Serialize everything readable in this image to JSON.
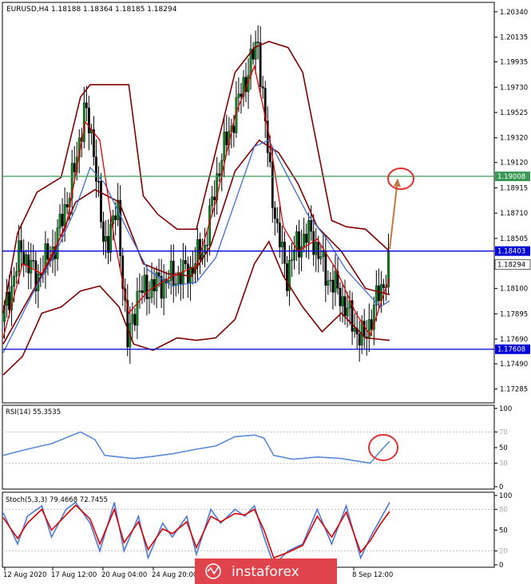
{
  "chart_data": [
    {
      "type": "candlestick",
      "title": "EURUSD,H4  1.18188 1.18364 1.18185 1.18294",
      "ylim": [
        1.1718,
        1.2041
      ],
      "y_ticks": [
        "1.20340",
        "1.20135",
        "1.19935",
        "1.19730",
        "1.19525",
        "1.19320",
        "1.19120",
        "1.18915",
        "1.18710",
        "1.18505",
        "1.18300",
        "1.18100",
        "1.17895",
        "1.17690",
        "1.17490",
        "1.17285"
      ],
      "x_ticks": [
        "12 Aug 2020",
        "17 Aug 12:00",
        "20 Aug 04:00",
        "24 Aug 20:00",
        "8 Sep 12:00"
      ],
      "n_bars": 160,
      "close_path": [
        [
          0,
          1.1783
        ],
        [
          8,
          1.1842
        ],
        [
          14,
          1.1818
        ],
        [
          22,
          1.1845
        ],
        [
          30,
          1.1905
        ],
        [
          34,
          1.1955
        ],
        [
          38,
          1.1925
        ],
        [
          42,
          1.1845
        ],
        [
          48,
          1.1872
        ],
        [
          52,
          1.1765
        ],
        [
          56,
          1.1805
        ],
        [
          62,
          1.1812
        ],
        [
          70,
          1.1818
        ],
        [
          78,
          1.1825
        ],
        [
          84,
          1.1845
        ],
        [
          90,
          1.191
        ],
        [
          100,
          1.1975
        ],
        [
          106,
          1.201
        ],
        [
          110,
          1.192
        ],
        [
          114,
          1.1855
        ],
        [
          118,
          1.1822
        ],
        [
          122,
          1.1845
        ],
        [
          128,
          1.1855
        ],
        [
          134,
          1.1822
        ],
        [
          140,
          1.1805
        ],
        [
          146,
          1.1778
        ],
        [
          150,
          1.1768
        ],
        [
          154,
          1.1795
        ],
        [
          158,
          1.1815
        ],
        [
          160,
          1.1829
        ]
      ],
      "series": [
        {
          "name": "Bollinger Upper",
          "color": "#800000",
          "values": [
            [
              0,
              1.179
            ],
            [
              6,
              1.1855
            ],
            [
              14,
              1.1888
            ],
            [
              24,
              1.19
            ],
            [
              32,
              1.1965
            ],
            [
              36,
              1.1975
            ],
            [
              44,
              1.1975
            ],
            [
              52,
              1.1975
            ],
            [
              58,
              1.1885
            ],
            [
              64,
              1.187
            ],
            [
              72,
              1.1858
            ],
            [
              80,
              1.1858
            ],
            [
              86,
              1.1905
            ],
            [
              96,
              1.1985
            ],
            [
              104,
              1.2005
            ],
            [
              110,
              1.201
            ],
            [
              118,
              1.2005
            ],
            [
              124,
              1.1985
            ],
            [
              130,
              1.1925
            ],
            [
              136,
              1.1865
            ],
            [
              142,
              1.186
            ],
            [
              150,
              1.1858
            ],
            [
              160,
              1.184
            ]
          ]
        },
        {
          "name": "Bollinger Middle",
          "color": "#800000",
          "values": [
            [
              0,
              1.1765
            ],
            [
              10,
              1.18
            ],
            [
              20,
              1.1835
            ],
            [
              30,
              1.188
            ],
            [
              38,
              1.189
            ],
            [
              48,
              1.188
            ],
            [
              58,
              1.183
            ],
            [
              68,
              1.1822
            ],
            [
              78,
              1.182
            ],
            [
              86,
              1.1845
            ],
            [
              96,
              1.1905
            ],
            [
              106,
              1.193
            ],
            [
              114,
              1.192
            ],
            [
              122,
              1.1895
            ],
            [
              130,
              1.186
            ],
            [
              140,
              1.184
            ],
            [
              150,
              1.181
            ],
            [
              160,
              1.1805
            ]
          ]
        },
        {
          "name": "Bollinger Lower",
          "color": "#800000",
          "values": [
            [
              0,
              1.174
            ],
            [
              8,
              1.1755
            ],
            [
              16,
              1.179
            ],
            [
              24,
              1.1795
            ],
            [
              32,
              1.1808
            ],
            [
              40,
              1.1812
            ],
            [
              48,
              1.1795
            ],
            [
              54,
              1.1765
            ],
            [
              62,
              1.176
            ],
            [
              72,
              1.177
            ],
            [
              80,
              1.1768
            ],
            [
              88,
              1.177
            ],
            [
              96,
              1.1785
            ],
            [
              104,
              1.183
            ],
            [
              110,
              1.1848
            ],
            [
              116,
              1.182
            ],
            [
              124,
              1.1795
            ],
            [
              132,
              1.1775
            ],
            [
              140,
              1.179
            ],
            [
              150,
              1.177
            ],
            [
              160,
              1.1768
            ]
          ]
        },
        {
          "name": "MA blue",
          "color": "#3e6fd6",
          "values": [
            [
              0,
              1.1758
            ],
            [
              12,
              1.1805
            ],
            [
              22,
              1.184
            ],
            [
              30,
              1.1875
            ],
            [
              36,
              1.1908
            ],
            [
              42,
              1.1895
            ],
            [
              52,
              1.1855
            ],
            [
              60,
              1.1825
            ],
            [
              70,
              1.1812
            ],
            [
              80,
              1.1815
            ],
            [
              88,
              1.1835
            ],
            [
              96,
              1.188
            ],
            [
              104,
              1.1925
            ],
            [
              110,
              1.193
            ],
            [
              118,
              1.19
            ],
            [
              126,
              1.187
            ],
            [
              134,
              1.185
            ],
            [
              142,
              1.1825
            ],
            [
              150,
              1.1808
            ],
            [
              156,
              1.1795
            ],
            [
              160,
              1.18
            ]
          ]
        },
        {
          "name": "MA red",
          "color": "#e00000",
          "values": [
            [
              0,
              1.177
            ],
            [
              8,
              1.183
            ],
            [
              16,
              1.1822
            ],
            [
              26,
              1.186
            ],
            [
              34,
              1.1945
            ],
            [
              40,
              1.193
            ],
            [
              46,
              1.185
            ],
            [
              52,
              1.179
            ],
            [
              60,
              1.1808
            ],
            [
              70,
              1.182
            ],
            [
              80,
              1.1828
            ],
            [
              88,
              1.188
            ],
            [
              96,
              1.195
            ],
            [
              104,
              1.199
            ],
            [
              110,
              1.1935
            ],
            [
              116,
              1.186
            ],
            [
              122,
              1.184
            ],
            [
              130,
              1.185
            ],
            [
              138,
              1.1825
            ],
            [
              146,
              1.179
            ],
            [
              152,
              1.1772
            ],
            [
              158,
              1.1808
            ],
            [
              160,
              1.1818
            ]
          ]
        }
      ],
      "levels": [
        {
          "value": 1.19008,
          "label": "1.19008",
          "color": "#3a9a55"
        },
        {
          "value": 1.18403,
          "label": "1.18403",
          "color": "#0000d8"
        },
        {
          "value": 1.17608,
          "label": "1.17608",
          "color": "#0000d8"
        }
      ],
      "current_price": "1.18294",
      "annotations": {
        "arrow_to": [
          1.1898
        ],
        "circle_color": "#e03030",
        "arrow_color": "#c07a40"
      }
    },
    {
      "type": "line",
      "title": "RSI(14) 55.3535",
      "ylim": [
        0,
        100
      ],
      "y_ticks": [
        "100",
        "70",
        "50",
        "30",
        "0"
      ],
      "levels": [
        70,
        30
      ],
      "series": [
        {
          "name": "RSI",
          "color": "#5a8ad8",
          "values": [
            [
              0,
              40
            ],
            [
              10,
              48
            ],
            [
              20,
              55
            ],
            [
              28,
              65
            ],
            [
              32,
              70
            ],
            [
              38,
              60
            ],
            [
              42,
              40
            ],
            [
              48,
              38
            ],
            [
              54,
              36
            ],
            [
              60,
              38
            ],
            [
              70,
              42
            ],
            [
              80,
              48
            ],
            [
              88,
              52
            ],
            [
              96,
              64
            ],
            [
              104,
              66
            ],
            [
              108,
              62
            ],
            [
              112,
              40
            ],
            [
              120,
              35
            ],
            [
              130,
              38
            ],
            [
              140,
              36
            ],
            [
              148,
              32
            ],
            [
              152,
              30
            ],
            [
              156,
              45
            ],
            [
              160,
              58
            ]
          ]
        }
      ]
    },
    {
      "type": "line",
      "title": "Stoch(5,3,3) 79.4668 72.7455",
      "ylim": [
        0,
        100
      ],
      "y_ticks": [
        "100",
        "80",
        "50",
        "20",
        "0"
      ],
      "levels": [
        80,
        20
      ],
      "series": [
        {
          "name": "%K",
          "color": "#4a7ad6",
          "values": [
            [
              0,
              75
            ],
            [
              6,
              30
            ],
            [
              10,
              70
            ],
            [
              16,
              85
            ],
            [
              20,
              40
            ],
            [
              26,
              80
            ],
            [
              30,
              90
            ],
            [
              36,
              60
            ],
            [
              40,
              20
            ],
            [
              46,
              90
            ],
            [
              50,
              20
            ],
            [
              56,
              70
            ],
            [
              60,
              10
            ],
            [
              66,
              60
            ],
            [
              70,
              40
            ],
            [
              76,
              70
            ],
            [
              80,
              15
            ],
            [
              86,
              80
            ],
            [
              90,
              60
            ],
            [
              96,
              80
            ],
            [
              100,
              70
            ],
            [
              104,
              85
            ],
            [
              108,
              40
            ],
            [
              112,
              0
            ],
            [
              118,
              20
            ],
            [
              124,
              30
            ],
            [
              130,
              80
            ],
            [
              136,
              30
            ],
            [
              142,
              85
            ],
            [
              148,
              10
            ],
            [
              152,
              40
            ],
            [
              156,
              65
            ],
            [
              160,
              90
            ]
          ]
        },
        {
          "name": "%D",
          "color": "#e00000",
          "values": [
            [
              0,
              68
            ],
            [
              6,
              38
            ],
            [
              10,
              60
            ],
            [
              16,
              80
            ],
            [
              20,
              50
            ],
            [
              26,
              72
            ],
            [
              30,
              86
            ],
            [
              36,
              66
            ],
            [
              40,
              30
            ],
            [
              46,
              80
            ],
            [
              50,
              32
            ],
            [
              56,
              62
            ],
            [
              60,
              22
            ],
            [
              66,
              52
            ],
            [
              70,
              45
            ],
            [
              76,
              62
            ],
            [
              80,
              25
            ],
            [
              86,
              70
            ],
            [
              90,
              62
            ],
            [
              96,
              74
            ],
            [
              100,
              72
            ],
            [
              104,
              80
            ],
            [
              108,
              50
            ],
            [
              112,
              10
            ],
            [
              118,
              18
            ],
            [
              124,
              28
            ],
            [
              130,
              70
            ],
            [
              136,
              40
            ],
            [
              142,
              76
            ],
            [
              148,
              18
            ],
            [
              152,
              35
            ],
            [
              156,
              58
            ],
            [
              160,
              77
            ]
          ]
        }
      ]
    }
  ],
  "watermark": {
    "brand": "instaforex"
  }
}
